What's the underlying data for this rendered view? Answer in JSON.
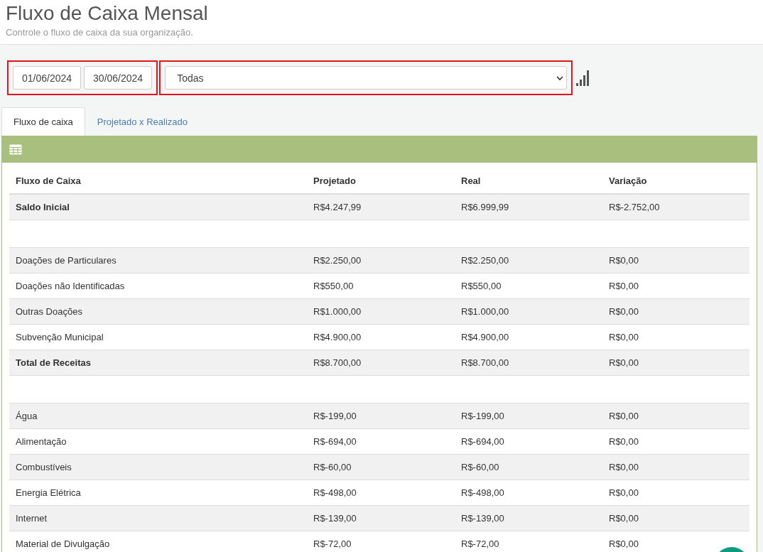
{
  "header": {
    "title": "Fluxo de Caixa Mensal",
    "subtitle": "Controle o fluxo de caixa da sua organização."
  },
  "filters": {
    "date_from": "01/06/2024",
    "date_to": "30/06/2024",
    "category": "Todas"
  },
  "tabs": [
    {
      "label": "Fluxo de caixa",
      "selected": true
    },
    {
      "label": "Projetado x Realizado",
      "selected": false
    }
  ],
  "table": {
    "columns": [
      "Fluxo de Caixa",
      "Projetado",
      "Real",
      "Variação"
    ],
    "rows": [
      {
        "kind": "total",
        "cells": [
          "Saldo Inicial",
          "R$4.247,99",
          "R$6.999,99",
          "R$-2.752,00"
        ]
      },
      {
        "kind": "spacer"
      },
      {
        "kind": "item",
        "cells": [
          "Doações de Particulares",
          "R$2.250,00",
          "R$2.250,00",
          "R$0,00"
        ]
      },
      {
        "kind": "item",
        "cells": [
          "Doações não Identificadas",
          "R$550,00",
          "R$550,00",
          "R$0,00"
        ]
      },
      {
        "kind": "item",
        "cells": [
          "Outras Doações",
          "R$1.000,00",
          "R$1.000,00",
          "R$0,00"
        ]
      },
      {
        "kind": "item",
        "cells": [
          "Subvenção Municipal",
          "R$4.900,00",
          "R$4.900,00",
          "R$0,00"
        ]
      },
      {
        "kind": "total",
        "cells": [
          "Total de Receitas",
          "R$8.700,00",
          "R$8.700,00",
          "R$0,00"
        ]
      },
      {
        "kind": "spacer"
      },
      {
        "kind": "item",
        "cells": [
          "Água",
          "R$-199,00",
          "R$-199,00",
          "R$0,00"
        ]
      },
      {
        "kind": "item",
        "cells": [
          "Alimentação",
          "R$-694,00",
          "R$-694,00",
          "R$0,00"
        ]
      },
      {
        "kind": "item",
        "cells": [
          "Combustíveis",
          "R$-60,00",
          "R$-60,00",
          "R$0,00"
        ]
      },
      {
        "kind": "item",
        "cells": [
          "Energia Elétrica",
          "R$-498,00",
          "R$-498,00",
          "R$0,00"
        ]
      },
      {
        "kind": "item",
        "cells": [
          "Internet",
          "R$-139,00",
          "R$-139,00",
          "R$0,00"
        ]
      },
      {
        "kind": "item",
        "cells": [
          "Material de Divulgação",
          "R$-72,00",
          "R$-72,00",
          "R$0,00"
        ]
      }
    ]
  }
}
